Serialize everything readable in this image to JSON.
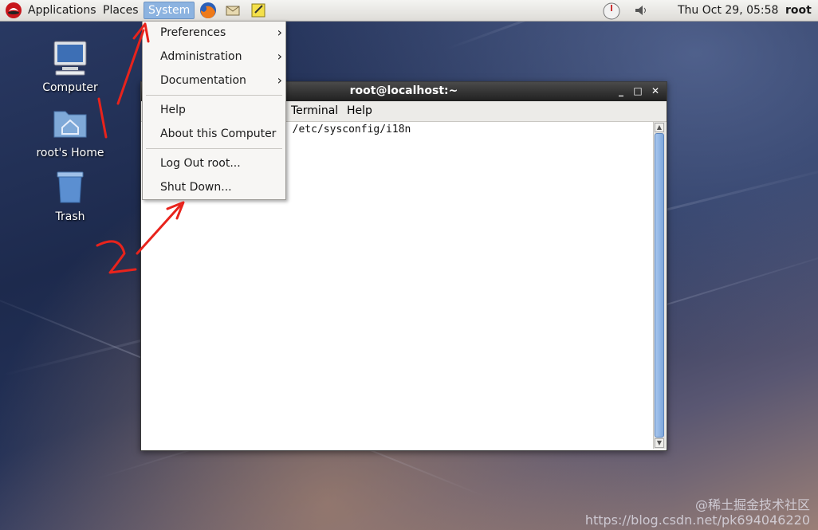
{
  "top_panel": {
    "applications": "Applications",
    "places": "Places",
    "system": "System",
    "clock": "Thu Oct 29, 05:58",
    "user": "root",
    "icons": [
      "redhat-logo-icon",
      "firefox-icon",
      "mail-icon",
      "notes-icon",
      "update-icon",
      "volume-icon"
    ]
  },
  "desktop_icons": [
    {
      "label": "Computer",
      "icon": "computer-icon"
    },
    {
      "label": "root's Home",
      "icon": "home-folder-icon"
    },
    {
      "label": "Trash",
      "icon": "trash-icon"
    }
  ],
  "system_menu": {
    "items": [
      {
        "label": "Preferences",
        "submenu": true
      },
      {
        "label": "Administration",
        "submenu": true
      },
      {
        "label": "Documentation",
        "submenu": true
      },
      {
        "label": "Help",
        "submenu": false
      },
      {
        "label": "About this Computer",
        "submenu": false
      },
      {
        "label": "Log Out root...",
        "submenu": false
      },
      {
        "label": "Shut Down...",
        "submenu": false
      }
    ]
  },
  "terminal": {
    "title": "root@localhost:~",
    "menu": [
      "Terminal",
      "Help"
    ],
    "line": "m /etc/sysconfig/i18n"
  },
  "annotations": {
    "step1": "1",
    "step2": "2",
    "color": "#e8231c"
  },
  "watermark": {
    "line1": "@稀土掘金技术社区",
    "line2": "https://blog.csdn.net/pk694046220"
  }
}
